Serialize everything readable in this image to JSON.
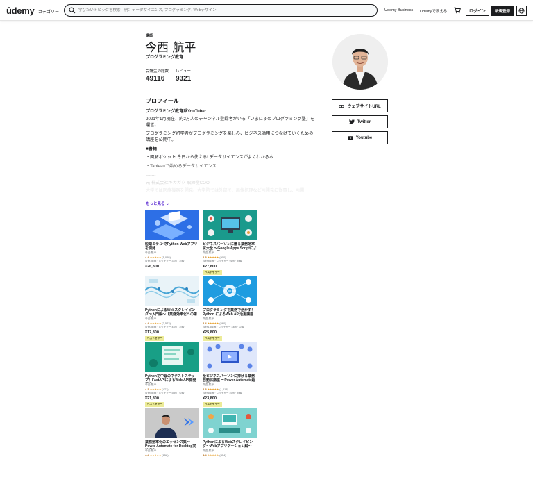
{
  "header": {
    "logo": "ûdemy",
    "categories": "カテゴリー",
    "search_placeholder": "学びたいトピックを検索　例：データサイエンス, プログラミング, Webデザイン",
    "business": "Udemy Business",
    "teach": "Udemyで教える",
    "login": "ログイン",
    "signup": "新規登録"
  },
  "profile": {
    "role": "講師",
    "name": "今西 航平",
    "headline": "プログラミング教育",
    "students_label": "受講生の総数",
    "students_value": "49116",
    "reviews_label": "レビュー",
    "reviews_value": "9321",
    "about_title": "プロフィール",
    "about_subtitle": "プログラミング教育系YouTuber",
    "para1": "2021年1月現在、約2万人のチャンネル登録者がいる「いまにゅのプログラミング塾」を運営。",
    "para2": "プログラミング初学者がプログラミングを楽しみ、ビジネス活用につなげていくための講座を公開中。",
    "books_heading": "■書籍",
    "book1": "・図解ポケット 今日から使える! データサイエンスがよくわかる本",
    "book2": "・Tableauで始めるデータサイエンス",
    "divider_text": "-------",
    "faded1": "元 株式会社キカガク 取締役COO",
    "faded2": "大学では医療機器を開発、大学院では外部で、画像処理などAI開発に従事し、AI開",
    "show_more": "もっと見る ⌄"
  },
  "links": {
    "website": "ウェブサイトURL",
    "twitter": "Twitter",
    "youtube": "Youtube"
  },
  "courses": [
    {
      "title": "短期ミラ-ンでPython Webアプリを開発",
      "instructor": "今西 航平",
      "rating": "4.4",
      "count": "(1,095)",
      "meta": "合計1時間 · レクチャー 31回 · 初級",
      "price": "¥26,800",
      "badge": ""
    },
    {
      "title": "ビジネスパーソンに贈る業務効率化大全 〜Google Apps Scriptによる実践の同...",
      "instructor": "今西 航平",
      "rating": "4.5",
      "count": "(900)",
      "meta": "合計9時間 · レクチャー 91回 · 初級",
      "price": "¥27,800",
      "badge": "ベストセラー"
    },
    {
      "title": "PythonによるWebスクレイピング〜入門編〜【業務効率化への第一歩】",
      "instructor": "今西 航平",
      "rating": "4.4",
      "count": "(3,573)",
      "meta": "合計3時間 · レクチャー 44回 · 初級",
      "price": "¥17,800",
      "badge": "ベストセラー"
    },
    {
      "title": "プログラミングを業務で活かす！Python によるWeb API活用講座",
      "instructor": "今西 航平",
      "rating": "4.4",
      "count": "(580)",
      "meta": "合計4.5時間 · レクチャー 44回 · 中級",
      "price": "¥25,800",
      "badge": "ベストセラー"
    },
    {
      "title": "Python初中級のネクストステップ！FastAPIによるWeb API開発講座",
      "instructor": "今西 航平",
      "rating": "4.3",
      "count": "(471)",
      "meta": "合計5時間 · レクチャー 55回 · 中級",
      "price": "¥21,800",
      "badge": "ベストセラー"
    },
    {
      "title": "全ビジネスパーソンに捧げる業務自動化講座 〜Power Automate超入門〜 (...",
      "instructor": "今西 航平",
      "rating": "4.5",
      "count": "(1,218)",
      "meta": "合計3時間 · レクチャー 49回 · 初級",
      "price": "¥23,800",
      "badge": "ベストセラー"
    },
    {
      "title": "業務効率化のエッセンス集〜Power Automate for Desktop実践講座〜",
      "instructor": "今西 航平",
      "rating": "4.4",
      "count": "(658)",
      "meta": "",
      "price": "",
      "badge": ""
    },
    {
      "title": "PythonによるWebスクレイピング〜Webアプリケーション編〜",
      "instructor": "今西 航平",
      "rating": "4.4",
      "count": "(834)",
      "meta": "",
      "price": "",
      "badge": ""
    }
  ]
}
